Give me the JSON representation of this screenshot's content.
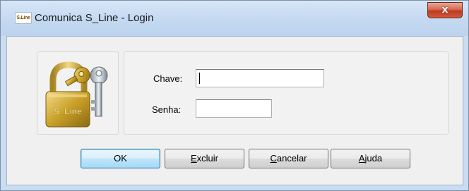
{
  "window": {
    "title": "Comunica S_Line - Login",
    "app_icon_text": "S.Line",
    "close_glyph": "x",
    "icon_name": "lock-and-keys-icon"
  },
  "form": {
    "chave": {
      "label": "Chave:",
      "value": "",
      "placeholder": ""
    },
    "senha": {
      "label": "Senha:",
      "value": "",
      "placeholder": ""
    }
  },
  "logo": {
    "lock_text": "S_Line"
  },
  "buttons": {
    "ok": {
      "label": "OK"
    },
    "excluir": {
      "first": "E",
      "rest": "xcluir"
    },
    "cancelar": {
      "first": "C",
      "rest": "ancelar"
    },
    "ajuda": {
      "first": "A",
      "rest": "juda"
    }
  },
  "colors": {
    "titlebar": "#c4d9f1",
    "close_button": "#c0391f",
    "client_background": "#f0f0f0",
    "default_button": "#bee6fd",
    "lock_gold": "#c9a028"
  }
}
